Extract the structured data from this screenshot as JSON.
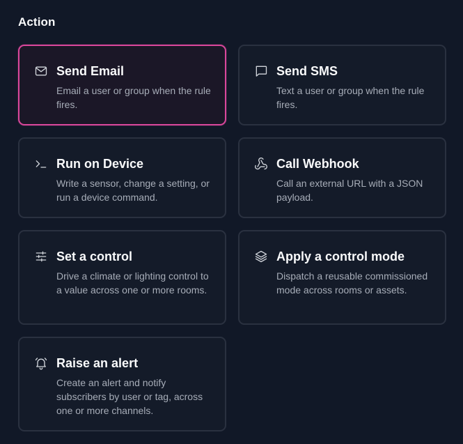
{
  "section": {
    "title": "Action"
  },
  "actions": [
    {
      "title": "Send Email",
      "description": "Email a user or group when the rule fires.",
      "icon": "mail-icon",
      "selected": true
    },
    {
      "title": "Send SMS",
      "description": "Text a user or group when the rule fires.",
      "icon": "message-icon",
      "selected": false
    },
    {
      "title": "Run on Device",
      "description": "Write a sensor, change a setting, or run a device command.",
      "icon": "terminal-icon",
      "selected": false
    },
    {
      "title": "Call Webhook",
      "description": "Call an external URL with a JSON payload.",
      "icon": "webhook-icon",
      "selected": false
    },
    {
      "title": "Set a control",
      "description": "Drive a climate or lighting control to a value across one or more rooms.",
      "icon": "sliders-icon",
      "selected": false
    },
    {
      "title": "Apply a control mode",
      "description": "Dispatch a reusable commissioned mode across rooms or assets.",
      "icon": "layers-icon",
      "selected": false
    },
    {
      "title": "Raise an alert",
      "description": "Create an alert and notify subscribers by user or tag, across one or more channels.",
      "icon": "bell-icon",
      "selected": false
    }
  ],
  "colors": {
    "background": "#111827",
    "card_border": "#2a3140",
    "selected_border": "#d9479b"
  }
}
